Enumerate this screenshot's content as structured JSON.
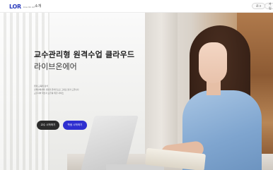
{
  "nav": {
    "logo_mark": "LOR",
    "logo_sub": "Live On Air",
    "link_intro": "소개",
    "login_label": "로그",
    "signup_label": "가입"
  },
  "hero": {
    "title": "교수관리형 원격수업 클라우드",
    "subtitle": "라이브온에어",
    "desc_lines": [
      "원격 교육의 정석",
      "강의실에서의 경험을 온라인으로 그대로 옮겨 드립니다",
      "교수자와 학습자 모두를 위한 서비스"
    ],
    "cta_primary": "교수 시작하기",
    "cta_secondary": "학생 시작하기"
  },
  "colors": {
    "brand": "#2a3bbd",
    "cta_blue": "#2e2fd0",
    "cta_dark": "#2b2b2b"
  }
}
